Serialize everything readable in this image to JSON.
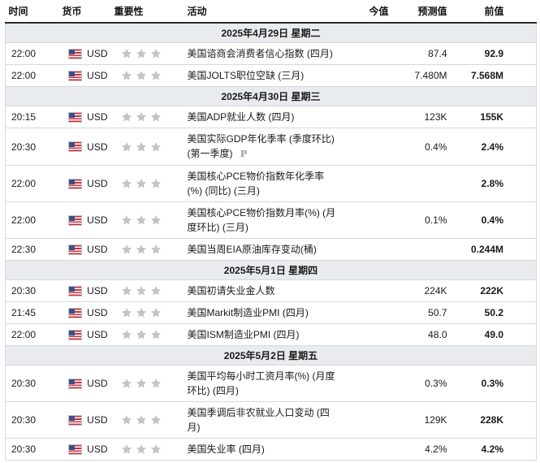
{
  "headers": {
    "time": "时间",
    "currency": "货币",
    "importance": "重要性",
    "event": "活动",
    "actual": "今值",
    "forecast": "预测值",
    "previous": "前值"
  },
  "days": [
    {
      "label": "2025年4月29日  星期二",
      "events": [
        {
          "time": "22:00",
          "currency": "USD",
          "event": "美国谘商会消费者信心指数 (四月)",
          "actual": "",
          "forecast": "87.4",
          "previous": "92.9"
        },
        {
          "time": "22:00",
          "currency": "USD",
          "event": "美国JOLTS职位空缺 (三月)",
          "actual": "",
          "forecast": "7.480M",
          "previous": "7.568M"
        }
      ]
    },
    {
      "label": "2025年4月30日  星期三",
      "events": [
        {
          "time": "20:15",
          "currency": "USD",
          "event": "美国ADP就业人数 (四月)",
          "actual": "",
          "forecast": "123K",
          "previous": "155K"
        },
        {
          "time": "20:30",
          "currency": "USD",
          "event": "美国实际GDP年化季率 (季度环比) (第一季度)",
          "mark": "P",
          "actual": "",
          "forecast": "0.4%",
          "previous": "2.4%"
        },
        {
          "time": "22:00",
          "currency": "USD",
          "event": "美国核心PCE物价指数年化季率 (%) (同比) (三月)",
          "actual": "",
          "forecast": "",
          "previous": "2.8%"
        },
        {
          "time": "22:00",
          "currency": "USD",
          "event": "美国核心PCE物价指数月率(%) (月度环比) (三月)",
          "actual": "",
          "forecast": "0.1%",
          "previous": "0.4%"
        },
        {
          "time": "22:30",
          "currency": "USD",
          "event": "美国当周EIA原油库存变动(桶)",
          "actual": "",
          "forecast": "",
          "previous": "0.244M"
        }
      ]
    },
    {
      "label": "2025年5月1日  星期四",
      "events": [
        {
          "time": "20:30",
          "currency": "USD",
          "event": "美国初请失业金人数",
          "actual": "",
          "forecast": "224K",
          "previous": "222K"
        },
        {
          "time": "21:45",
          "currency": "USD",
          "event": "美国Markit制造业PMI (四月)",
          "actual": "",
          "forecast": "50.7",
          "previous": "50.2"
        },
        {
          "time": "22:00",
          "currency": "USD",
          "event": "美国ISM制造业PMI (四月)",
          "actual": "",
          "forecast": "48.0",
          "previous": "49.0"
        }
      ]
    },
    {
      "label": "2025年5月2日  星期五",
      "events": [
        {
          "time": "20:30",
          "currency": "USD",
          "event": "美国平均每小时工资月率(%) (月度环比) (四月)",
          "actual": "",
          "forecast": "0.3%",
          "previous": "0.3%"
        },
        {
          "time": "20:30",
          "currency": "USD",
          "event": "美国季调后非农就业人口变动 (四月)",
          "actual": "",
          "forecast": "129K",
          "previous": "228K"
        },
        {
          "time": "20:30",
          "currency": "USD",
          "event": "美国失业率 (四月)",
          "actual": "",
          "forecast": "4.2%",
          "previous": "4.2%"
        }
      ]
    }
  ],
  "importance_stars": 3,
  "colors": {
    "star": "#c4c4c4",
    "day_band": "#e9ebee",
    "border": "#d5d8dc"
  },
  "icons": {
    "flag": "us-flag-icon",
    "star": "star-icon",
    "preliminary": "p-mark-icon"
  }
}
